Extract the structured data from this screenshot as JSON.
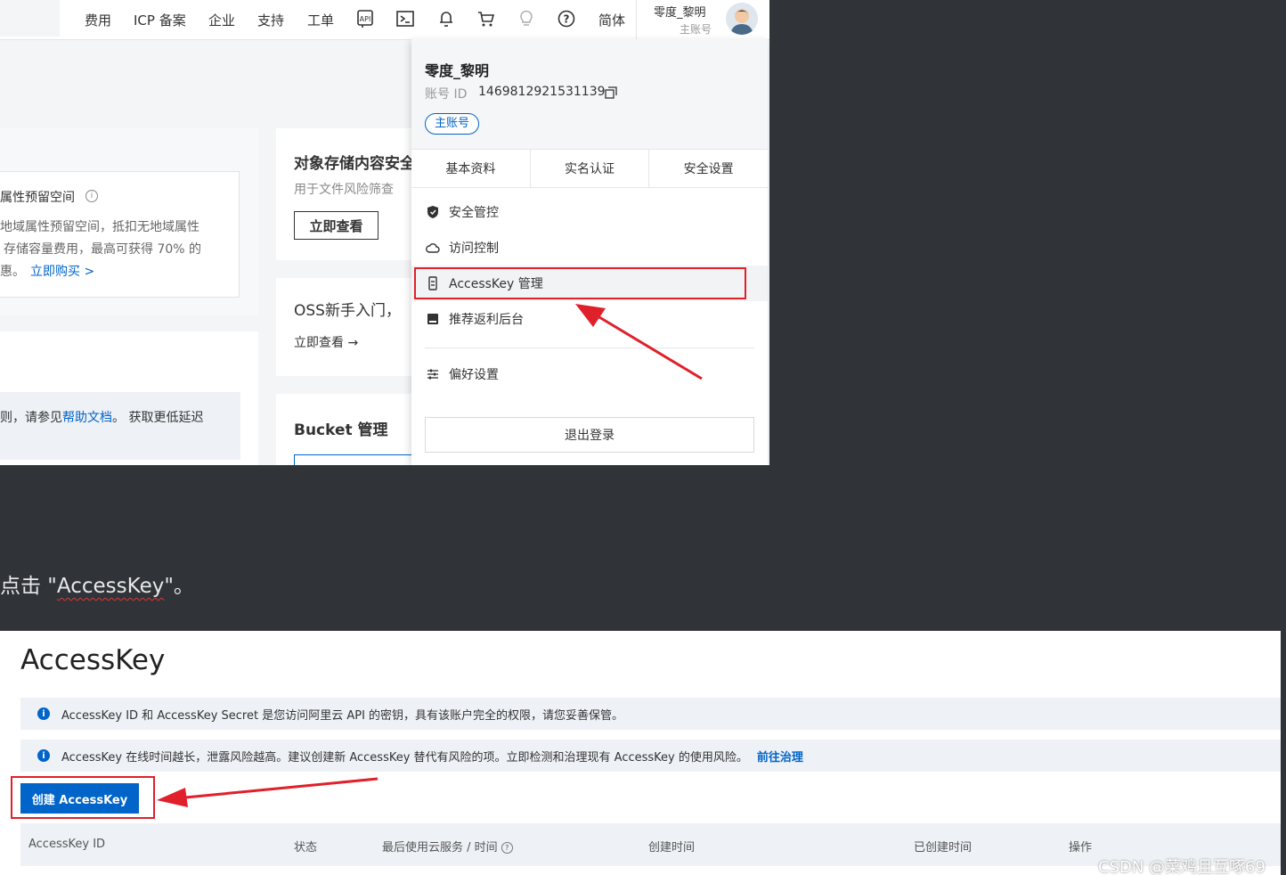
{
  "topbar": {
    "nav_items": [
      "费用",
      "ICP 备案",
      "企业",
      "支持",
      "工单",
      "简体"
    ],
    "icons": [
      "api-icon",
      "terminal-icon",
      "bell-icon",
      "cart-icon",
      "lightbulb-icon",
      "help-icon"
    ],
    "user_name": "零度_黎明",
    "user_role": "主账号"
  },
  "background_cards": {
    "left_title": "属性预留空间",
    "left_lines": [
      "地域属性预留空间，抵扣无地域属性",
      "存储容量费用，最高可获得 70% 的",
      "惠。"
    ],
    "left_link": "立即购买 >",
    "help_text": "则，请参见",
    "help_link": "帮助文档",
    "help_tail": "。 获取更低延迟",
    "mid1_title": "对象存储内容安全",
    "mid1_desc": "用于文件风险筛查",
    "mid1_button": "立即查看",
    "mid2_title": "OSS新手入门，",
    "mid2_link": "立即查看 →",
    "mid3_title": "Bucket 管理"
  },
  "dropdown": {
    "name": "零度_黎明",
    "id_label": "账号 ID",
    "id_value": "1469812921531139",
    "badge": "主账号",
    "tabs": [
      "基本资料",
      "实名认证",
      "安全设置"
    ],
    "items": [
      {
        "label": "安全管控",
        "icon": "shield-icon"
      },
      {
        "label": "访问控制",
        "icon": "cloud-icon"
      },
      {
        "label": "AccessKey 管理",
        "icon": "key-icon"
      },
      {
        "label": "推荐返利后台",
        "icon": "gift-icon"
      },
      {
        "label": "偏好设置",
        "icon": "sliders-icon"
      }
    ],
    "logout": "退出登录"
  },
  "caption": {
    "prefix": "点击 \"",
    "keyword": "AccessKey",
    "suffix": "\"。"
  },
  "accesskey_page": {
    "title": "AccessKey",
    "notice1": "AccessKey ID 和 AccessKey Secret 是您访问阿里云 API 的密钥，具有该账户完全的权限，请您妥善保管。",
    "notice2": "AccessKey 在线时间越长，泄露风险越高。建议创建新 AccessKey 替代有风险的项。立即检测和治理现有 AccessKey 的使用风险。",
    "notice2_link": "前往治理",
    "create_button": "创建 AccessKey",
    "columns": [
      "AccessKey ID",
      "状态",
      "最后使用云服务 / 时间",
      "创建时间",
      "已创建时间",
      "操作"
    ]
  },
  "watermark": "CSDN @菜鸡且互啄69",
  "colors": {
    "accent": "#0064c8",
    "highlight": "#e0202a",
    "dark_bg": "#303338"
  }
}
